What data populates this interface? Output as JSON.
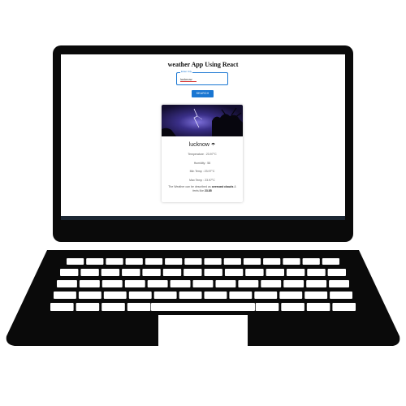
{
  "app": {
    "title": "weather App Using React"
  },
  "search": {
    "field_label": "Enter City",
    "field_value": "lucknow",
    "button_label": "SEARCH"
  },
  "card": {
    "city": "lucknow",
    "weather_icon": "cloud-rain-icon",
    "temperature": "Temperature : 23.97°C",
    "humidity": "Humidity : 56",
    "min_temp": "Min Temp : 23.97°C",
    "max_temp": "Max Temp : 23.97°C",
    "description_prefix": "The Weather can be described as ",
    "description_weather": "overcast clouds",
    "description_mid": " & feels like ",
    "description_feels": "23.85"
  },
  "colors": {
    "accent": "#1976d2",
    "laptop_body": "#0a0a0a",
    "screen_bezel": "#111111"
  }
}
